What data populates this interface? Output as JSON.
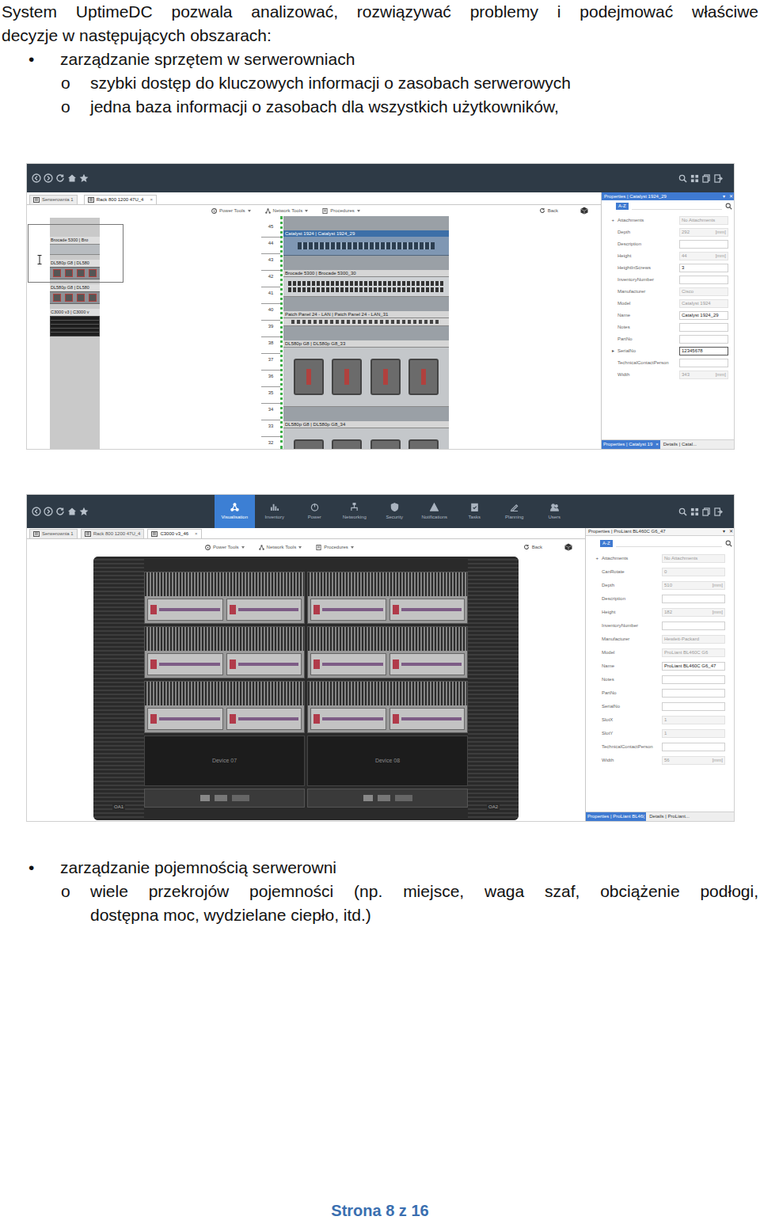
{
  "intro": [
    "System UptimeDC pozwala analizować, rozwiązywać problemy i podejmować właściwe",
    "decyzje w następujących obszarach:"
  ],
  "list1": {
    "marker": "•",
    "text": "zarządzanie sprzętem w serwerowniach",
    "sub": [
      {
        "marker": "o",
        "lines": [
          "szybki dostęp do kluczowych informacji o zasobach serwerowych"
        ]
      },
      {
        "marker": "o",
        "lines": [
          "jedna baza informacji o zasobach dla wszystkich użytkowników,"
        ]
      }
    ]
  },
  "screen1": {
    "tabs": [
      {
        "label": "Serwerownia 1",
        "selected": false,
        "close": null
      },
      {
        "label": "Rack 800 1200 47U_4",
        "selected": true,
        "close": "×"
      }
    ],
    "toolbar": [
      "Power Tools",
      "Network Tools",
      "Procedures"
    ],
    "back": "Back",
    "mini_rack": [
      {
        "label": "Brocade 5300 | Bro",
        "kind": "san"
      },
      {
        "label": "DL580p G8 | DL580",
        "kind": "server"
      },
      {
        "label": "DL580p G8 | DL580",
        "kind": "server"
      },
      {
        "label": "C3000 v3 | C3000 v",
        "kind": "blade"
      }
    ],
    "ruler": [
      "45",
      "44",
      "43",
      "42",
      "41",
      "40",
      "39",
      "38",
      "37",
      "36",
      "35",
      "34",
      "33",
      "32"
    ],
    "devices": [
      {
        "label": "Catalyst 1924 | Catalyst 1924_29",
        "kind": "switch",
        "selected": true
      },
      {
        "label": "Brocade 5300 | Brocade 5300_30",
        "kind": "san",
        "selected": false
      },
      {
        "label": "Patch Panel 24 - LAN | Patch Panel 24 - LAN_31",
        "kind": "patch",
        "selected": false
      },
      {
        "label": "DL580p G8 | DL580p G8_33",
        "kind": "server",
        "selected": false
      },
      {
        "label": "DL580p G8 | DL580p G8_34",
        "kind": "server",
        "selected": false
      }
    ],
    "properties": {
      "title": "Properties | Catalyst 1924_29",
      "controls": [
        "▾",
        "✕"
      ],
      "sort": "A-Z",
      "rows": [
        {
          "marker": "+",
          "label": "Attachments",
          "value": "No Attachments",
          "unit": null,
          "readonly": true,
          "selected": false
        },
        {
          "marker": null,
          "label": "Depth",
          "value": "292",
          "unit": "[mm]",
          "readonly": true,
          "selected": false
        },
        {
          "marker": null,
          "label": "Description",
          "value": "",
          "unit": null,
          "readonly": false,
          "selected": false
        },
        {
          "marker": null,
          "label": "Height",
          "value": "44",
          "unit": "[mm]",
          "readonly": true,
          "selected": false
        },
        {
          "marker": null,
          "label": "HeightInScrews",
          "value": "3",
          "unit": null,
          "readonly": false,
          "selected": false
        },
        {
          "marker": null,
          "label": "InventoryNumber",
          "value": "",
          "unit": null,
          "readonly": false,
          "selected": false
        },
        {
          "marker": null,
          "label": "Manufacturer",
          "value": "Cisco",
          "unit": null,
          "readonly": true,
          "selected": false
        },
        {
          "marker": null,
          "label": "Model",
          "value": "Catalyst 1924",
          "unit": null,
          "readonly": true,
          "selected": false
        },
        {
          "marker": null,
          "label": "Name",
          "value": "Catalyst 1924_29",
          "unit": null,
          "readonly": false,
          "selected": false
        },
        {
          "marker": null,
          "label": "Notes",
          "value": "",
          "unit": null,
          "readonly": false,
          "selected": false
        },
        {
          "marker": null,
          "label": "PartNo",
          "value": "",
          "unit": null,
          "readonly": false,
          "selected": false
        },
        {
          "marker": "▸",
          "label": "SerialNo",
          "value": "12345678",
          "unit": null,
          "readonly": false,
          "selected": true
        },
        {
          "marker": null,
          "label": "TechnicalContactPerson",
          "value": "",
          "unit": null,
          "readonly": false,
          "selected": false
        },
        {
          "marker": null,
          "label": "Width",
          "value": "343",
          "unit": "[mm]",
          "readonly": true,
          "selected": false
        }
      ],
      "bottom_tabs": [
        {
          "label": "Properties | Catalyst 19",
          "close": "×",
          "selected": true
        },
        {
          "label": "Details | Catal...",
          "close": null,
          "selected": false
        }
      ]
    }
  },
  "screen2": {
    "nav": [
      {
        "label": "Visualisation",
        "selected": true
      },
      {
        "label": "Inventory",
        "selected": false
      },
      {
        "label": "Power",
        "selected": false
      },
      {
        "label": "Networking",
        "selected": false
      },
      {
        "label": "Security",
        "selected": false
      },
      {
        "label": "Notifications",
        "selected": false
      },
      {
        "label": "Tasks",
        "selected": false
      },
      {
        "label": "Planning",
        "selected": false
      },
      {
        "label": "Users",
        "selected": false
      }
    ],
    "tabs": [
      {
        "label": "Serwerownia 1",
        "selected": false,
        "close": null
      },
      {
        "label": "Rack 800 1200 47U_4",
        "selected": false,
        "close": null
      },
      {
        "label": "C3000 v3_46",
        "selected": true,
        "close": "×"
      }
    ],
    "toolbar": [
      "Power Tools",
      "Network Tools",
      "Procedures"
    ],
    "back": "Back",
    "bays": [
      {
        "kind": "blade",
        "label": null
      },
      {
        "kind": "blade",
        "label": null
      },
      {
        "kind": "blade",
        "label": null
      },
      {
        "kind": "blade",
        "label": null
      },
      {
        "kind": "blade",
        "label": null
      },
      {
        "kind": "blade",
        "label": null
      },
      {
        "kind": "empty",
        "label": "Device 07"
      },
      {
        "kind": "empty",
        "label": "Device 08"
      }
    ],
    "corner_labels": [
      "OA1",
      "OA2"
    ],
    "properties": {
      "title": "Properties | ProLiant BL460C G6_47",
      "controls": [
        "▾",
        "✕"
      ],
      "sort": "A-Z",
      "rows": [
        {
          "marker": "+",
          "label": "Attachments",
          "value": "No Attachments",
          "unit": null,
          "readonly": true,
          "selected": false
        },
        {
          "marker": null,
          "label": "CanRotate",
          "value": "0",
          "unit": null,
          "readonly": true,
          "selected": false
        },
        {
          "marker": null,
          "label": "Depth",
          "value": "510",
          "unit": "[mm]",
          "readonly": true,
          "selected": false
        },
        {
          "marker": null,
          "label": "Description",
          "value": "",
          "unit": null,
          "readonly": false,
          "selected": false
        },
        {
          "marker": null,
          "label": "Height",
          "value": "182",
          "unit": "[mm]",
          "readonly": true,
          "selected": false
        },
        {
          "marker": null,
          "label": "InventoryNumber",
          "value": "",
          "unit": null,
          "readonly": false,
          "selected": false
        },
        {
          "marker": null,
          "label": "Manufacturer",
          "value": "Hewlett-Packard",
          "unit": null,
          "readonly": true,
          "selected": false
        },
        {
          "marker": null,
          "label": "Model",
          "value": "ProLiant BL460C G6",
          "unit": null,
          "readonly": true,
          "selected": false
        },
        {
          "marker": null,
          "label": "Name",
          "value": "ProLiant BL460C G6_47",
          "unit": null,
          "readonly": false,
          "selected": false
        },
        {
          "marker": null,
          "label": "Notes",
          "value": "",
          "unit": null,
          "readonly": false,
          "selected": false
        },
        {
          "marker": null,
          "label": "PartNo",
          "value": "",
          "unit": null,
          "readonly": false,
          "selected": false
        },
        {
          "marker": null,
          "label": "SerialNo",
          "value": "",
          "unit": null,
          "readonly": false,
          "selected": false
        },
        {
          "marker": null,
          "label": "SlotX",
          "value": "1",
          "unit": null,
          "readonly": true,
          "selected": false
        },
        {
          "marker": null,
          "label": "SlotY",
          "value": "1",
          "unit": null,
          "readonly": true,
          "selected": false
        },
        {
          "marker": null,
          "label": "TechnicalContactPerson",
          "value": "",
          "unit": null,
          "readonly": false,
          "selected": false
        },
        {
          "marker": null,
          "label": "Width",
          "value": "56",
          "unit": "[mm]",
          "readonly": true,
          "selected": false
        }
      ],
      "bottom_tabs": [
        {
          "label": "Properties | ProLiant BL46(",
          "close": null,
          "selected": true
        },
        {
          "label": "Details | ProLiant...",
          "close": null,
          "selected": false
        }
      ]
    }
  },
  "list2": {
    "marker": "•",
    "text": "zarządzanie pojemnością serwerowni",
    "sub": [
      {
        "marker": "o",
        "lines": [
          "wiele przekrojów pojemności (np. miejsce, waga szaf, obciążenie podłogi,",
          "dostępna moc, wydzielane ciepło, itd.)"
        ]
      }
    ]
  },
  "footer": "Strona 8 z 16"
}
